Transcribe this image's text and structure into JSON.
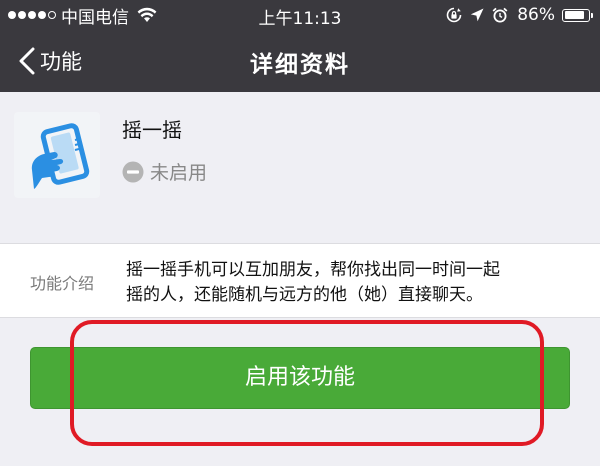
{
  "status_bar": {
    "signal_filled": 4,
    "signal_total": 5,
    "carrier": "中国电信",
    "time": "上午11:13",
    "battery_percent_text": "86%",
    "battery_level": 0.86,
    "icons": [
      "wifi-icon",
      "rotation-lock-icon",
      "location-arrow-icon",
      "alarm-icon",
      "battery-icon"
    ]
  },
  "nav": {
    "back_label": "功能",
    "title": "详细资料"
  },
  "feature": {
    "icon": "shake-phone-icon",
    "name": "摇一摇",
    "status": "未启用",
    "status_icon": "disabled-minus-icon"
  },
  "intro": {
    "label": "功能介绍",
    "text_line1": "摇一摇手机可以互加朋友，帮你找出同一时间一起",
    "text_line2": "摇的人，还能随机与远方的他（她）直接聊天。"
  },
  "action": {
    "enable_label": "启用该功能"
  },
  "colors": {
    "bar_background": "#3a393e",
    "page_background": "#efeff4",
    "button_green": "#49aa38",
    "highlight_red": "#e01a25",
    "icon_blue": "#2b8fe2"
  }
}
